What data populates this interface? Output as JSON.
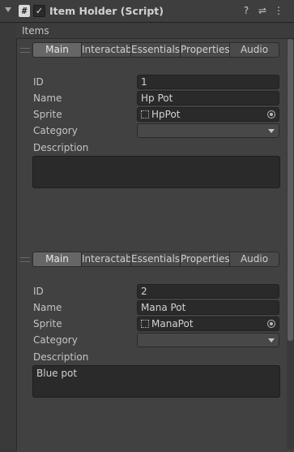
{
  "component": {
    "title": "Item Holder (Script)",
    "script_glyph": "#",
    "enabled_glyph": "✓",
    "header_icons": [
      "?",
      "⇌",
      "⋮"
    ]
  },
  "list": {
    "title": "Items",
    "tabs": [
      "Main",
      "Interactable",
      "Essentials",
      "Properties",
      "Audio"
    ],
    "active_tab": 0,
    "labels": {
      "id": "ID",
      "name": "Name",
      "sprite": "Sprite",
      "category": "Category",
      "description": "Description"
    },
    "items": [
      {
        "id": "1",
        "name": "Hp Pot",
        "sprite": "HpPot",
        "category": "",
        "description": ""
      },
      {
        "id": "2",
        "name": "Mana Pot",
        "sprite": "ManaPot",
        "category": "",
        "description": "Blue pot"
      }
    ]
  }
}
